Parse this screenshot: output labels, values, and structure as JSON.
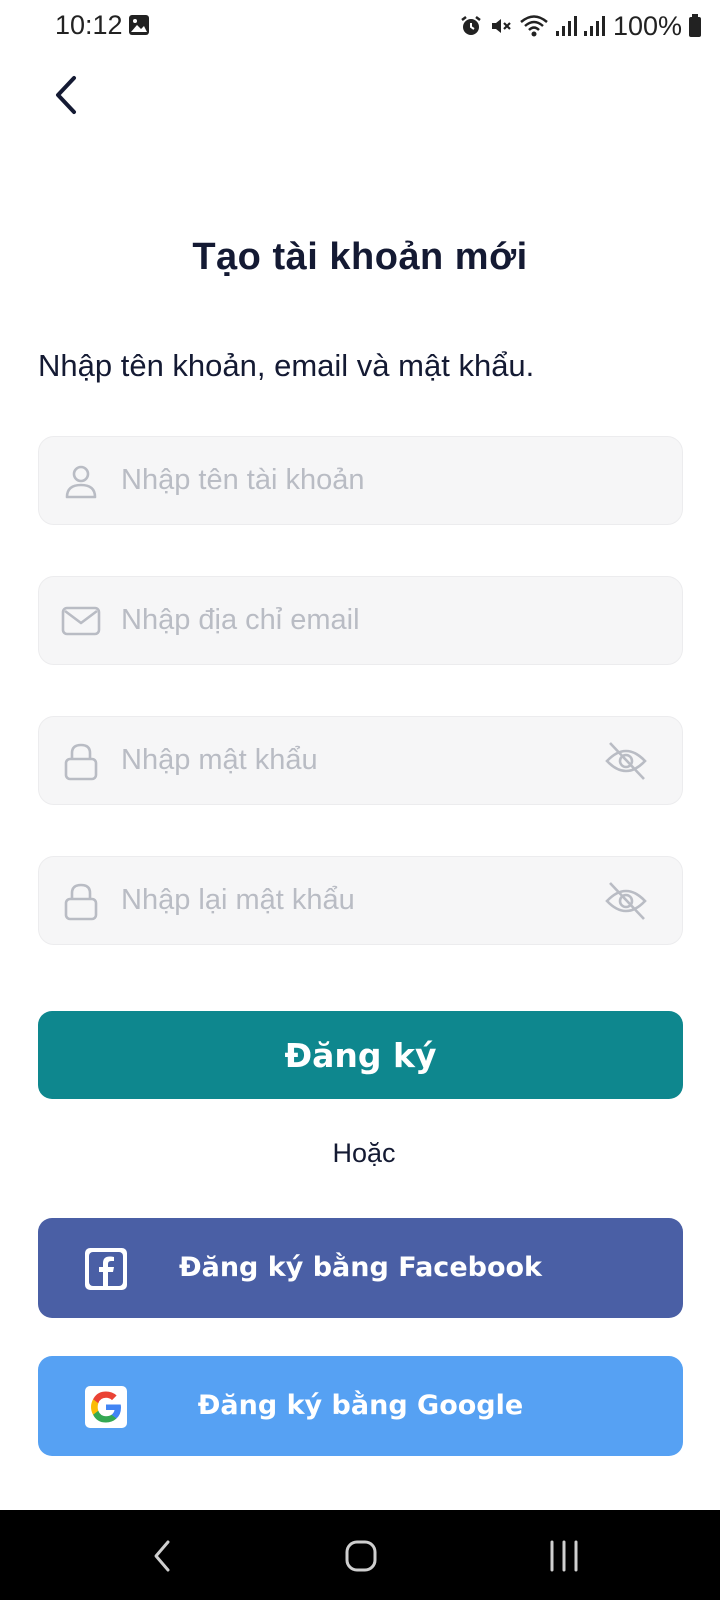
{
  "status_bar": {
    "time": "10:12",
    "battery": "100%",
    "icons": [
      "gallery-icon",
      "alarm-icon",
      "mute-icon",
      "wifi-icon",
      "signal-icon",
      "signal-icon",
      "battery-icon"
    ]
  },
  "header": {
    "title": "Tạo tài khoản mới",
    "subtitle": "Nhập tên khoản, email và mật khẩu."
  },
  "form": {
    "username": {
      "placeholder": "Nhập tên tài khoản",
      "value": ""
    },
    "email": {
      "placeholder": "Nhập địa chỉ email",
      "value": ""
    },
    "password": {
      "placeholder": "Nhập mật khẩu",
      "value": ""
    },
    "confirm_password": {
      "placeholder": "Nhập lại mật khẩu",
      "value": ""
    }
  },
  "actions": {
    "register_label": "Đăng ký",
    "or_label": "Hoặc",
    "facebook_label": "Đăng ký bằng Facebook",
    "google_label": "Đăng ký bằng Google"
  },
  "colors": {
    "primary": "#0e878e",
    "facebook": "#4a5fa5",
    "google": "#56a1f3",
    "title": "#141a33"
  }
}
